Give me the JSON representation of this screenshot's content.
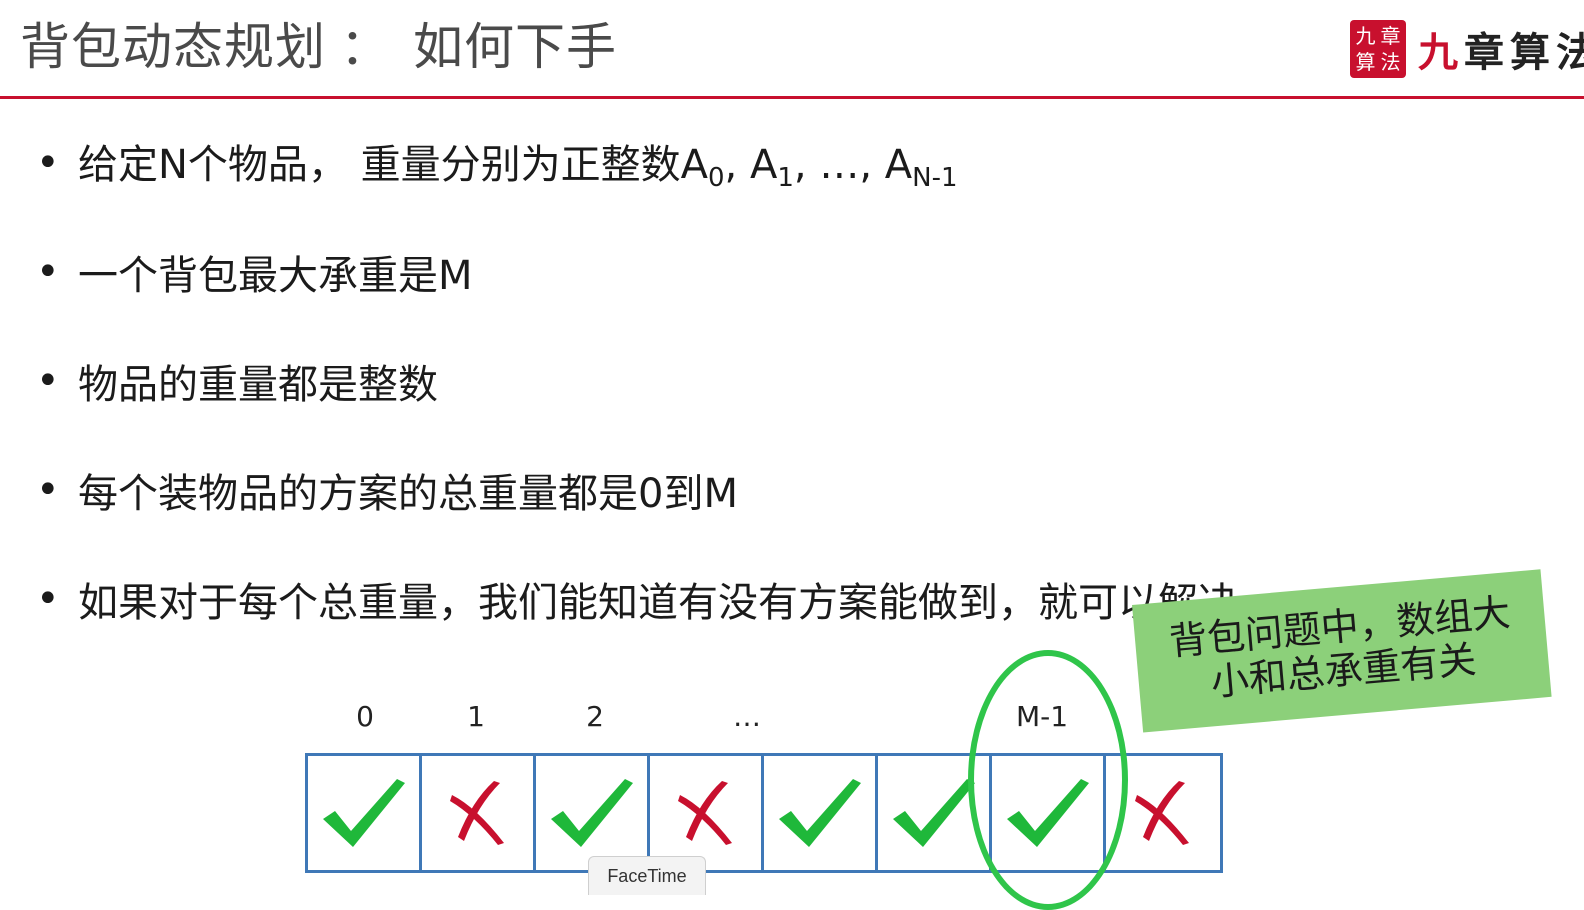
{
  "header": {
    "title": "背包动态规划",
    "title_sep": "：",
    "title_rest": "如何下手",
    "logo_seal": [
      "九",
      "章",
      "算",
      "法"
    ],
    "logo_text_first": "九",
    "logo_text_rest": "章算法"
  },
  "bullets": {
    "b1_pre": "给定N个物品， 重量分别为正整数A",
    "b1_sub0": "0",
    "b1_sep1": ", A",
    "b1_sub1": "1",
    "b1_sep2": ", …, A",
    "b1_subn": "N-1",
    "b2": "一个背包最大承重是M",
    "b3": "物品的重量都是整数",
    "b4": "每个装物品的方案的总重量都是0到M",
    "b5": "如果对于每个总重量，我们能知道有没有方案能做到，就可以解决"
  },
  "callout": {
    "line1": "背包问题中，数组大",
    "line2": "小和总承重有关"
  },
  "array_labels": [
    "0",
    "1",
    "2",
    "…",
    "M-1"
  ],
  "cells": [
    "check",
    "cross",
    "check",
    "cross",
    "check",
    "check",
    "check",
    "cross"
  ],
  "colors": {
    "check": "#1fb83a",
    "cross": "#c8102e",
    "accent": "#c8102e",
    "grid": "#3f78b7",
    "callout": "#8cd07a"
  },
  "dock_tooltip": "FaceTime"
}
